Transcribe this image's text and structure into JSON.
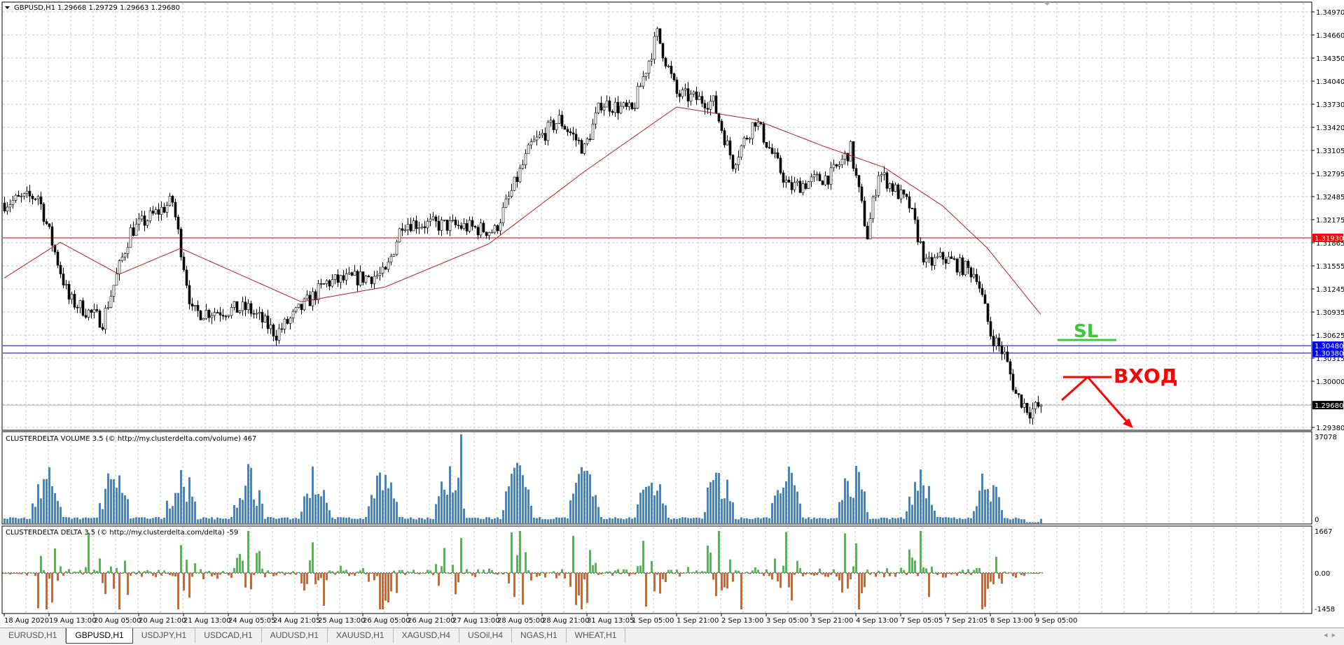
{
  "header": {
    "symbol": "GBPUSD,H1",
    "ohlc": "1.29668 1.29729 1.29663 1.29680"
  },
  "indicators": {
    "volume_title": "CLUSTERDELTA VOLUME 3.5 (© http://my.clusterdelta.com/volume) 467",
    "delta_title": "CLUSTERDELTA DELTA 3.5 (© http://my.clusterdelta.com/delta) -59",
    "volume_axis": [
      "37078",
      "0"
    ],
    "delta_axis": [
      "1667",
      "0.00",
      "-1458"
    ]
  },
  "price_axis": [
    "1.34970",
    "1.34660",
    "1.34350",
    "1.34040",
    "1.33730",
    "1.33420",
    "1.33105",
    "1.32795",
    "1.32485",
    "1.32175",
    "1.31865",
    "1.31555",
    "1.31245",
    "1.30935",
    "1.30625",
    "1.30315",
    "1.30000",
    "1.29380"
  ],
  "levels": {
    "red": {
      "value": "1.31930",
      "color": "#c00000"
    },
    "blue1": {
      "value": "1.30480",
      "color": "#0000c0"
    },
    "blue2": {
      "value": "1.30380",
      "color": "#0000c0"
    },
    "current": {
      "value": "1.29680",
      "color": "#000000"
    }
  },
  "annotations": {
    "sl": "SL",
    "entry": "ВХОД",
    "sl_color": "#3cc83c",
    "entry_color": "#ff0000"
  },
  "time_axis": [
    "18 Aug 2020",
    "19 Aug 13:00",
    "20 Aug 05:00",
    "20 Aug 21:00",
    "21 Aug 13:00",
    "24 Aug 05:05",
    "24 Aug 21:05",
    "25 Aug 13:00",
    "26 Aug 05:00",
    "26 Aug 21:00",
    "27 Aug 13:00",
    "28 Aug 05:00",
    "28 Aug 21:00",
    "31 Aug 13:05",
    "1 Sep 05:00",
    "1 Sep 21:00",
    "2 Sep 13:00",
    "3 Sep 05:00",
    "3 Sep 21:00",
    "4 Sep 13:00",
    "7 Sep 05:05",
    "7 Sep 21:05",
    "8 Sep 13:00",
    "9 Sep 05:00"
  ],
  "tabs": [
    {
      "label": "EURUSD,H1"
    },
    {
      "label": "GBPUSD,H1",
      "active": true
    },
    {
      "label": "USDJPY,H1"
    },
    {
      "label": "USDCAD,H1"
    },
    {
      "label": "AUDUSD,H1"
    },
    {
      "label": "XAUUSD,H1"
    },
    {
      "label": "XAGUSD,H4"
    },
    {
      "label": "USOil,H4"
    },
    {
      "label": "NGAS,H1"
    },
    {
      "label": "WHEAT,H1"
    }
  ],
  "chart_data": {
    "type": "candlestick",
    "bars": 371,
    "price_range": [
      1.2938,
      1.3497
    ],
    "close_waypoints": [
      [
        0,
        1.324
      ],
      [
        12,
        1.325
      ],
      [
        23,
        1.311
      ],
      [
        35,
        1.3081
      ],
      [
        45,
        1.3202
      ],
      [
        60,
        1.3242
      ],
      [
        67,
        1.3092
      ],
      [
        87,
        1.3098
      ],
      [
        97,
        1.3064
      ],
      [
        115,
        1.3133
      ],
      [
        136,
        1.3144
      ],
      [
        142,
        1.3214
      ],
      [
        164,
        1.3208
      ],
      [
        175,
        1.3202
      ],
      [
        188,
        1.3317
      ],
      [
        198,
        1.3352
      ],
      [
        207,
        1.3312
      ],
      [
        213,
        1.3375
      ],
      [
        224,
        1.3363
      ],
      [
        233,
        1.3467
      ],
      [
        240,
        1.3386
      ],
      [
        253,
        1.3375
      ],
      [
        260,
        1.3294
      ],
      [
        268,
        1.3352
      ],
      [
        280,
        1.326
      ],
      [
        295,
        1.3277
      ],
      [
        302,
        1.3312
      ],
      [
        308,
        1.3196
      ],
      [
        312,
        1.3282
      ],
      [
        323,
        1.3236
      ],
      [
        329,
        1.3156
      ],
      [
        335,
        1.3167
      ],
      [
        347,
        1.3144
      ],
      [
        352,
        1.3064
      ],
      [
        357,
        1.3035
      ],
      [
        361,
        1.2983
      ],
      [
        366,
        1.296
      ],
      [
        370,
        1.2968
      ]
    ],
    "ma_waypoints": [
      [
        0,
        1.3139
      ],
      [
        20,
        1.3187
      ],
      [
        41,
        1.3144
      ],
      [
        63,
        1.3179
      ],
      [
        106,
        1.3107
      ],
      [
        136,
        1.3127
      ],
      [
        173,
        1.3185
      ],
      [
        207,
        1.3282
      ],
      [
        240,
        1.3369
      ],
      [
        268,
        1.3352
      ],
      [
        292,
        1.3317
      ],
      [
        314,
        1.3288
      ],
      [
        335,
        1.3236
      ],
      [
        351,
        1.3179
      ],
      [
        370,
        1.309
      ]
    ],
    "volume_max": 37078,
    "volume_spike_bar": 163,
    "delta_range": [
      -1458,
      1667
    ],
    "colors": {
      "volume": "#2e8ae6",
      "delta_pos": "#3cc83c",
      "delta_neg": "#f05a14",
      "ma": "#b22222"
    }
  }
}
